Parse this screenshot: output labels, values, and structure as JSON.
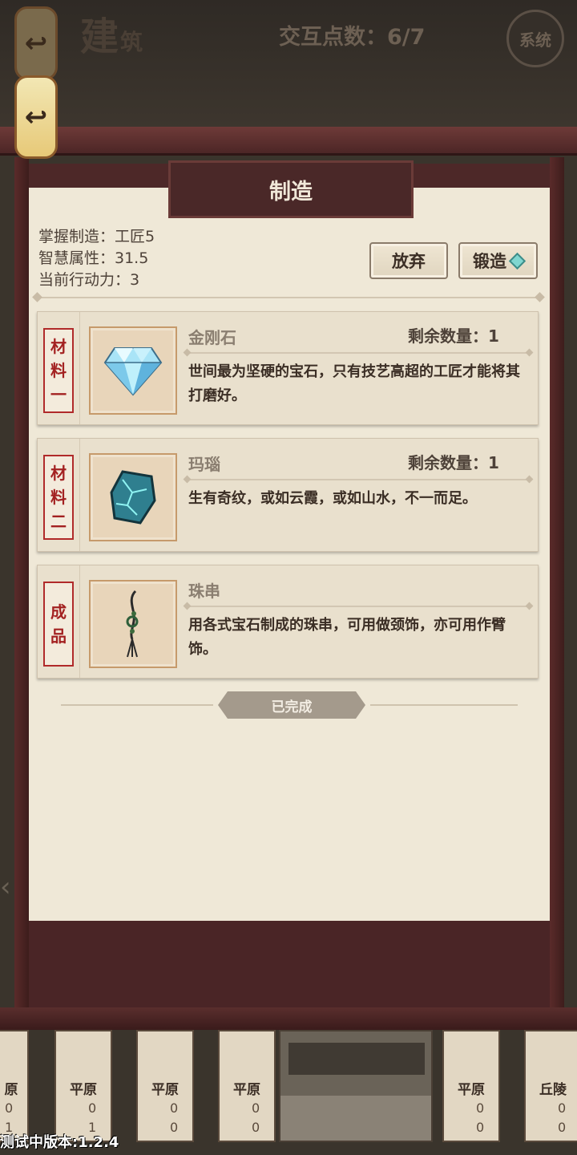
{
  "header": {
    "building_title": "建",
    "building_title_small": "筑",
    "interaction_points": "交互点数：6/7",
    "system_button": "系统",
    "back_icon_1": "↩",
    "back_icon_2": "↩"
  },
  "dialog": {
    "title": "制造",
    "stats": {
      "craft_level": "掌握制造：工匠5",
      "wisdom": "智慧属性：31.5",
      "action_points": "当前行动力：3"
    },
    "buttons": {
      "give_up": "放弃",
      "forge": "锻造"
    },
    "items": [
      {
        "tag": [
          "材",
          "料",
          "一"
        ],
        "name": "金刚石",
        "quantity": "剩余数量：1",
        "description": "世间最为坚硬的宝石，只有技艺高超的工匠才能将其打磨好。",
        "icon": "diamond-gem-icon"
      },
      {
        "tag": [
          "材",
          "料",
          "二"
        ],
        "name": "玛瑙",
        "quantity": "剩余数量：1",
        "description": "生有奇纹，或如云霞，或如山水，不一而足。",
        "icon": "agate-stone-icon"
      },
      {
        "tag": [
          "成",
          "品"
        ],
        "name": "珠串",
        "quantity": "",
        "description": "用各式宝石制成的珠串，可用做颈饰，亦可用作臂饰。",
        "icon": "bead-string-icon"
      }
    ],
    "status_label": "已完成"
  },
  "map_tiles": [
    {
      "name": "原",
      "n1": "0",
      "n2": "1"
    },
    {
      "name": "平原",
      "n1": "0",
      "n2": "1"
    },
    {
      "name": "平原",
      "n1": "0",
      "n2": "0"
    },
    {
      "name": "平原",
      "n1": "0",
      "n2": "0"
    },
    {
      "name": "平原",
      "n1": "0",
      "n2": "0"
    },
    {
      "name": "丘陵",
      "n1": "0",
      "n2": "0"
    }
  ],
  "side_arrow": "‹",
  "version": "测试中版本:1.2.4"
}
